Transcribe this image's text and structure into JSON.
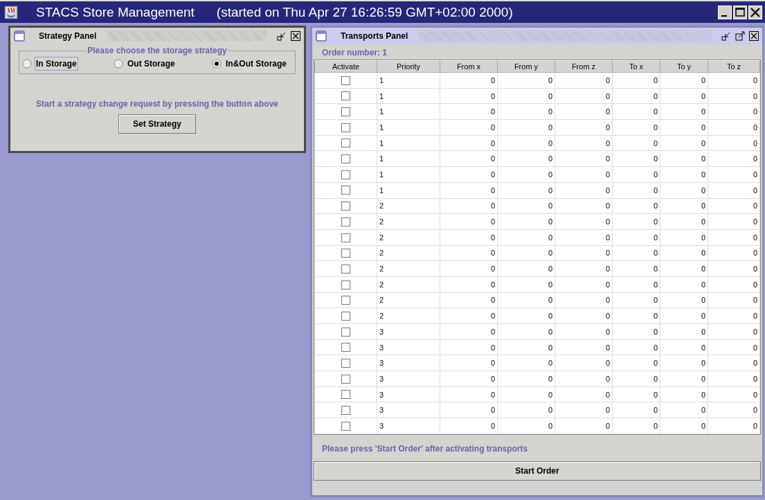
{
  "window": {
    "title": "STACS Store Management",
    "subtitle": "(started on Thu Apr 27 16:26:59 GMT+02:00 2000)"
  },
  "strategy_panel": {
    "title": "Strategy Panel",
    "group_label": "Please choose the storage strategy",
    "options": [
      {
        "label": "In Storage",
        "selected": false,
        "focused": true
      },
      {
        "label": "Out Storage",
        "selected": false,
        "focused": false
      },
      {
        "label": "In&Out Storage",
        "selected": true,
        "focused": false
      }
    ],
    "hint": "Start a strategy change request by pressing the button above",
    "button": "Set Strategy"
  },
  "transports_panel": {
    "title": "Transports Panel",
    "order_label": "Order number: 1",
    "columns": [
      "Activate",
      "Priority",
      "From x",
      "From y",
      "From z",
      "To x",
      "To y",
      "To z"
    ],
    "rows": [
      {
        "checked": false,
        "priority": "1",
        "values": [
          "0",
          "0",
          "0",
          "0",
          "0",
          "0"
        ]
      },
      {
        "checked": false,
        "priority": "1",
        "values": [
          "0",
          "0",
          "0",
          "0",
          "0",
          "0"
        ]
      },
      {
        "checked": false,
        "priority": "1",
        "values": [
          "0",
          "0",
          "0",
          "0",
          "0",
          "0"
        ]
      },
      {
        "checked": false,
        "priority": "1",
        "values": [
          "0",
          "0",
          "0",
          "0",
          "0",
          "0"
        ]
      },
      {
        "checked": false,
        "priority": "1",
        "values": [
          "0",
          "0",
          "0",
          "0",
          "0",
          "0"
        ]
      },
      {
        "checked": false,
        "priority": "1",
        "values": [
          "0",
          "0",
          "0",
          "0",
          "0",
          "0"
        ]
      },
      {
        "checked": false,
        "priority": "1",
        "values": [
          "0",
          "0",
          "0",
          "0",
          "0",
          "0"
        ]
      },
      {
        "checked": false,
        "priority": "1",
        "values": [
          "0",
          "0",
          "0",
          "0",
          "0",
          "0"
        ]
      },
      {
        "checked": false,
        "priority": "2",
        "values": [
          "0",
          "0",
          "0",
          "0",
          "0",
          "0"
        ]
      },
      {
        "checked": false,
        "priority": "2",
        "values": [
          "0",
          "0",
          "0",
          "0",
          "0",
          "0"
        ]
      },
      {
        "checked": false,
        "priority": "2",
        "values": [
          "0",
          "0",
          "0",
          "0",
          "0",
          "0"
        ]
      },
      {
        "checked": false,
        "priority": "2",
        "values": [
          "0",
          "0",
          "0",
          "0",
          "0",
          "0"
        ]
      },
      {
        "checked": false,
        "priority": "2",
        "values": [
          "0",
          "0",
          "0",
          "0",
          "0",
          "0"
        ]
      },
      {
        "checked": false,
        "priority": "2",
        "values": [
          "0",
          "0",
          "0",
          "0",
          "0",
          "0"
        ]
      },
      {
        "checked": false,
        "priority": "2",
        "values": [
          "0",
          "0",
          "0",
          "0",
          "0",
          "0"
        ]
      },
      {
        "checked": false,
        "priority": "2",
        "values": [
          "0",
          "0",
          "0",
          "0",
          "0",
          "0"
        ]
      },
      {
        "checked": false,
        "priority": "3",
        "values": [
          "0",
          "0",
          "0",
          "0",
          "0",
          "0"
        ]
      },
      {
        "checked": false,
        "priority": "3",
        "values": [
          "0",
          "0",
          "0",
          "0",
          "0",
          "0"
        ]
      },
      {
        "checked": false,
        "priority": "3",
        "values": [
          "0",
          "0",
          "0",
          "0",
          "0",
          "0"
        ]
      },
      {
        "checked": false,
        "priority": "3",
        "values": [
          "0",
          "0",
          "0",
          "0",
          "0",
          "0"
        ]
      },
      {
        "checked": false,
        "priority": "3",
        "values": [
          "0",
          "0",
          "0",
          "0",
          "0",
          "0"
        ]
      },
      {
        "checked": false,
        "priority": "3",
        "values": [
          "0",
          "0",
          "0",
          "0",
          "0",
          "0"
        ]
      },
      {
        "checked": false,
        "priority": "3",
        "values": [
          "0",
          "0",
          "0",
          "0",
          "0",
          "0"
        ]
      }
    ],
    "hint": "Please press 'Start Order' after activating transports",
    "button": "Start Order"
  }
}
